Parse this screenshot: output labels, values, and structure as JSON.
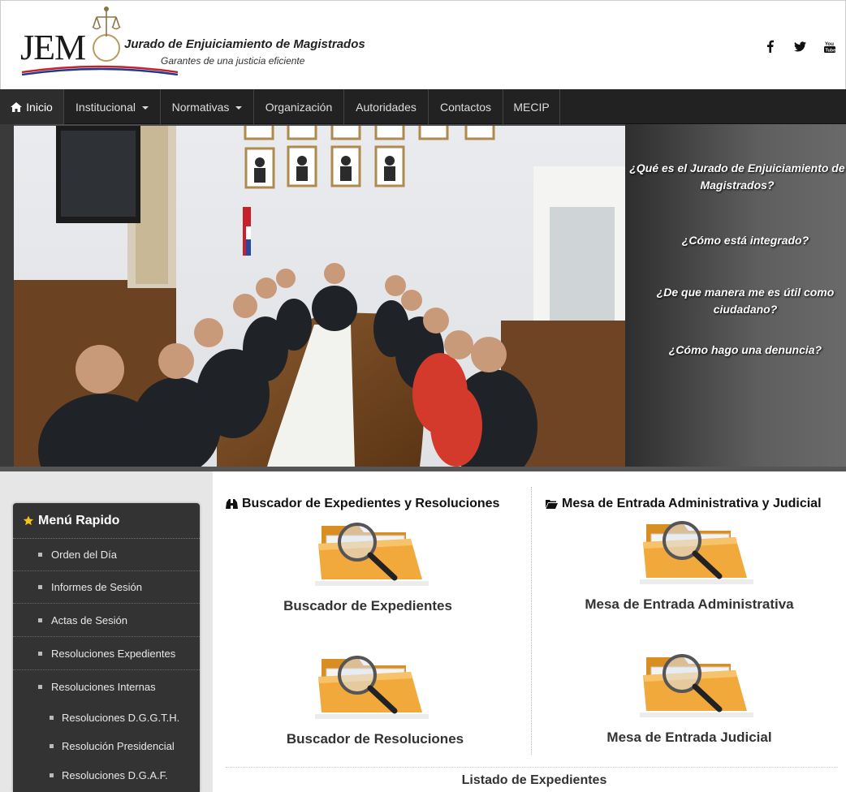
{
  "header": {
    "logo_text": "JEM",
    "title": "Jurado de Enjuiciamiento de Magistrados",
    "subtitle": "Garantes de una justicia eficiente",
    "social": [
      "facebook-icon",
      "twitter-icon",
      "youtube-icon"
    ]
  },
  "nav": {
    "items": [
      {
        "label": "Inicio",
        "icon": "home-icon",
        "active": true
      },
      {
        "label": "Institucional",
        "dropdown": true
      },
      {
        "label": "Normativas",
        "dropdown": true
      },
      {
        "label": "Organización"
      },
      {
        "label": "Autoridades"
      },
      {
        "label": "Contactos"
      },
      {
        "label": "MECIP"
      }
    ]
  },
  "hero": {
    "questions": [
      "¿Qué es el Jurado de Enjuiciamiento de Magistrados?",
      "¿Cómo está integrado?",
      "¿De que manera me es útil como ciudadano?",
      "¿Cómo hago una denuncia?"
    ]
  },
  "sidebar": {
    "title": "Menú Rapido",
    "items": [
      "Orden del Día",
      "Informes de Sesión",
      "Actas de Sesión",
      "Resoluciones Expedientes",
      "Resoluciones Internas"
    ],
    "subitems": [
      "Resoluciones D.G.G.T.H.",
      "Resolución Presidencial",
      "Resoluciones D.G.A.F."
    ]
  },
  "main": {
    "left_heading": "Buscador de Expedientes y Resoluciones",
    "right_heading": "Mesa de Entrada Administrativa y Judicial",
    "cards": [
      "Buscador de Expedientes",
      "Mesa de Entrada Administrativa",
      "Buscador de Resoluciones",
      "Mesa de Entrada Judicial"
    ],
    "listing": "Listado de Expedientes"
  },
  "colors": {
    "navbar": "#222222",
    "menu_bg": "#333333",
    "star": "#f5c518",
    "folder": "#f2a93b"
  }
}
